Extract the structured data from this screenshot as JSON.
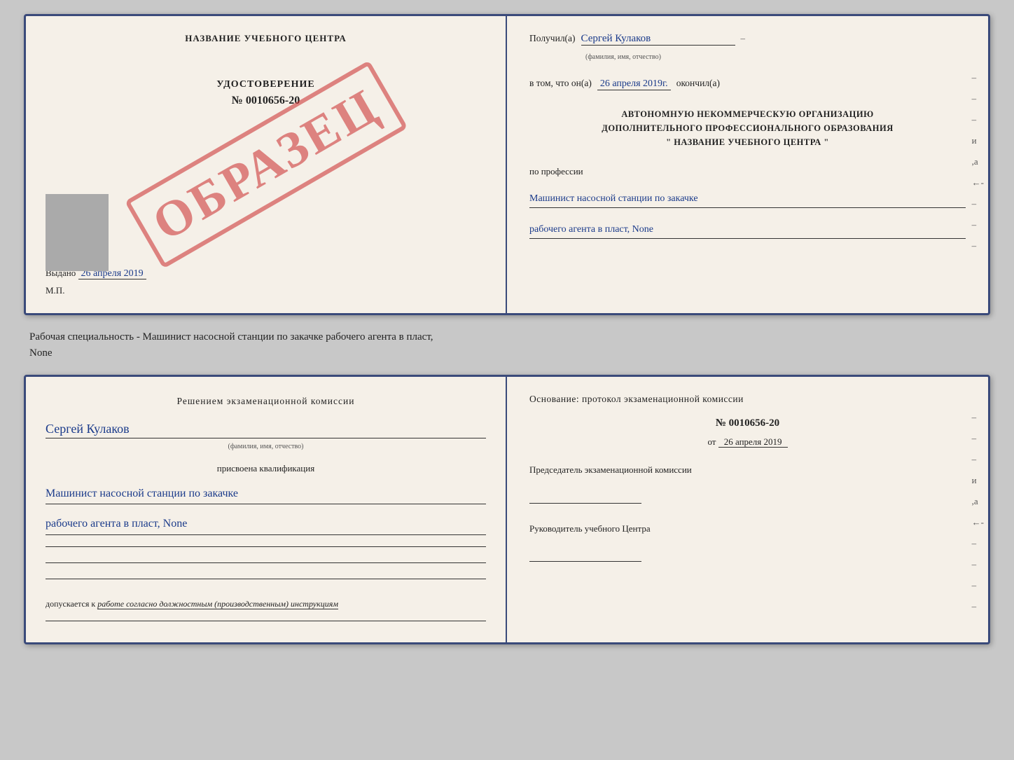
{
  "top_doc": {
    "left": {
      "school_name": "НАЗВАНИЕ УЧЕБНОГО ЦЕНТРА",
      "udostoverenie_title": "УДОСТОВЕРЕНИЕ",
      "udostoverenie_number": "№ 0010656-20",
      "vydano_label": "Выдано",
      "vydano_date": "26 апреля 2019",
      "mp_label": "М.П.",
      "obrazets": "ОБРАЗЕЦ"
    },
    "right": {
      "poluchil_label": "Получил(а)",
      "poluchil_name": "Сергей Кулаков",
      "familiya_hint": "(фамилия, имя, отчество)",
      "vtom_label": "в том, что он(а)",
      "vtom_date": "26 апреля 2019г.",
      "okonchil_label": "окончил(а)",
      "org_line1": "АВТОНОМНУЮ НЕКОММЕРЧЕСКУЮ ОРГАНИЗАЦИЮ",
      "org_line2": "ДОПОЛНИТЕЛЬНОГО ПРОФЕССИОНАЛЬНОГО ОБРАЗОВАНИЯ",
      "org_line3": "\"  НАЗВАНИЕ УЧЕБНОГО ЦЕНТРА  \"",
      "po_professii_label": "по профессии",
      "profession_line1": "Машинист насосной станции по закачке",
      "profession_line2": "рабочего агента в пласт, None"
    }
  },
  "middle": {
    "text_line1": "Рабочая специальность - Машинист насосной станции по закачке рабочего агента в пласт,",
    "text_line2": "None"
  },
  "bottom_doc": {
    "left": {
      "komissia_text": "Решением экзаменационной комиссии",
      "name_handwritten": "Сергей Кулаков",
      "familiya_hint": "(фамилия, имя, отчество)",
      "prisvoena_label": "присвоена квалификация",
      "profession_line1": "Машинист насосной станции по закачке",
      "profession_line2": "рабочего агента в пласт, None",
      "dopuskaetsya_label": "допускается к",
      "dopuskaetsya_text": "работе согласно должностным (производственным) инструкциям"
    },
    "right": {
      "osnovanie_label": "Основание: протокол экзаменационной комиссии",
      "protocol_number": "№ 0010656-20",
      "ot_label": "от",
      "ot_date": "26 апреля 2019",
      "predsedatel_label": "Председатель экзаменационной комиссии",
      "rukovoditel_label": "Руководитель учебного Центра"
    }
  }
}
